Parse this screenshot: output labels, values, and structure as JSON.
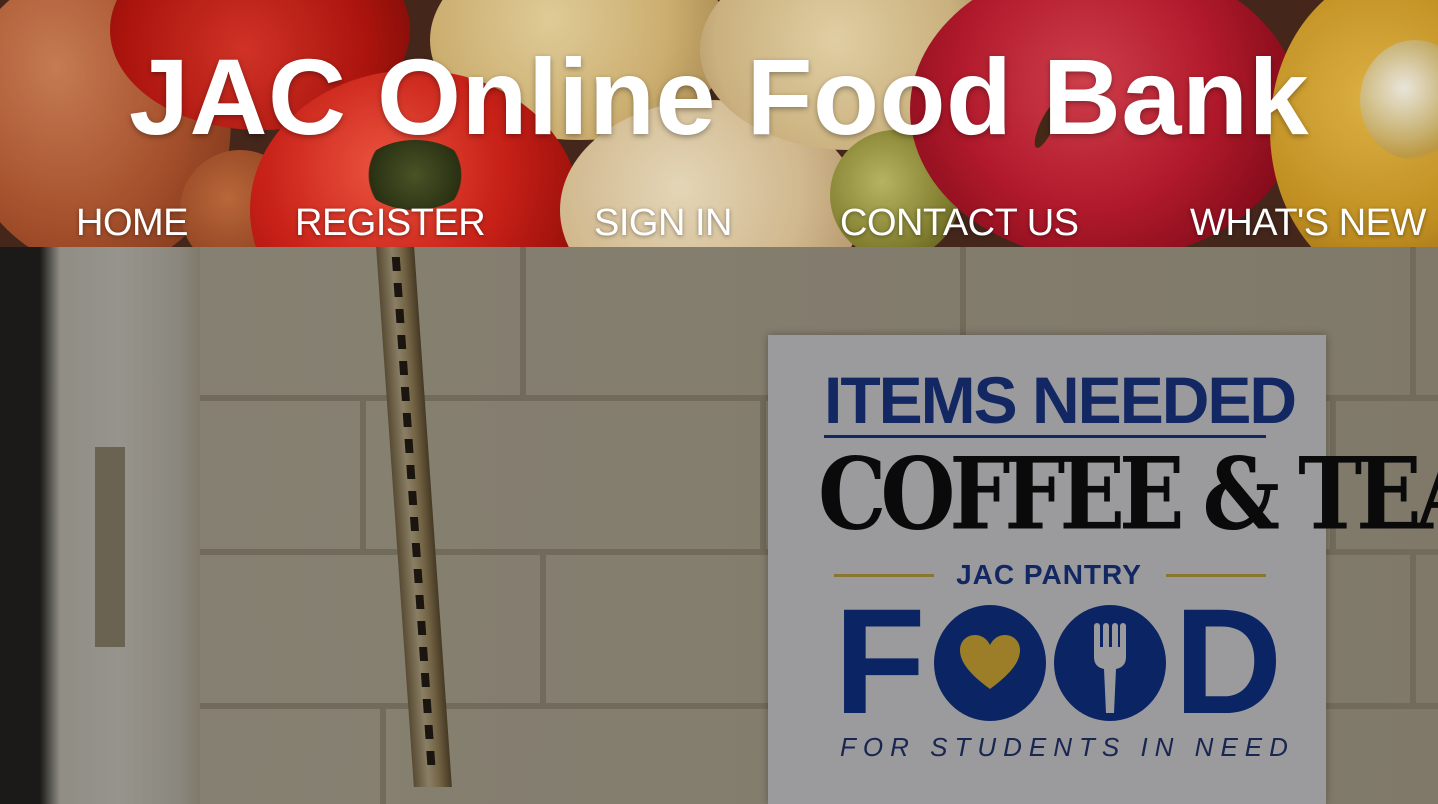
{
  "site": {
    "title": "JAC Online Food Bank"
  },
  "nav": {
    "items": [
      {
        "label": "HOME"
      },
      {
        "label": "REGISTER"
      },
      {
        "label": "SIGN IN"
      },
      {
        "label": "CONTACT US"
      },
      {
        "label": "WHAT'S NEW"
      }
    ]
  },
  "hero": {
    "poster": {
      "headline": "ITEMS NEEDED",
      "items": "COFFEE & TEA",
      "pantry": "JAC PANTRY",
      "food_letters": [
        "F",
        "O",
        "O",
        "D"
      ],
      "tagline": "FOR STUDENTS IN NEED"
    }
  },
  "colors": {
    "title_text": "#ffffff",
    "poster_blue": "#12399c",
    "poster_gold": "#d9b84d",
    "heart_yellow": "#f2c53d"
  }
}
